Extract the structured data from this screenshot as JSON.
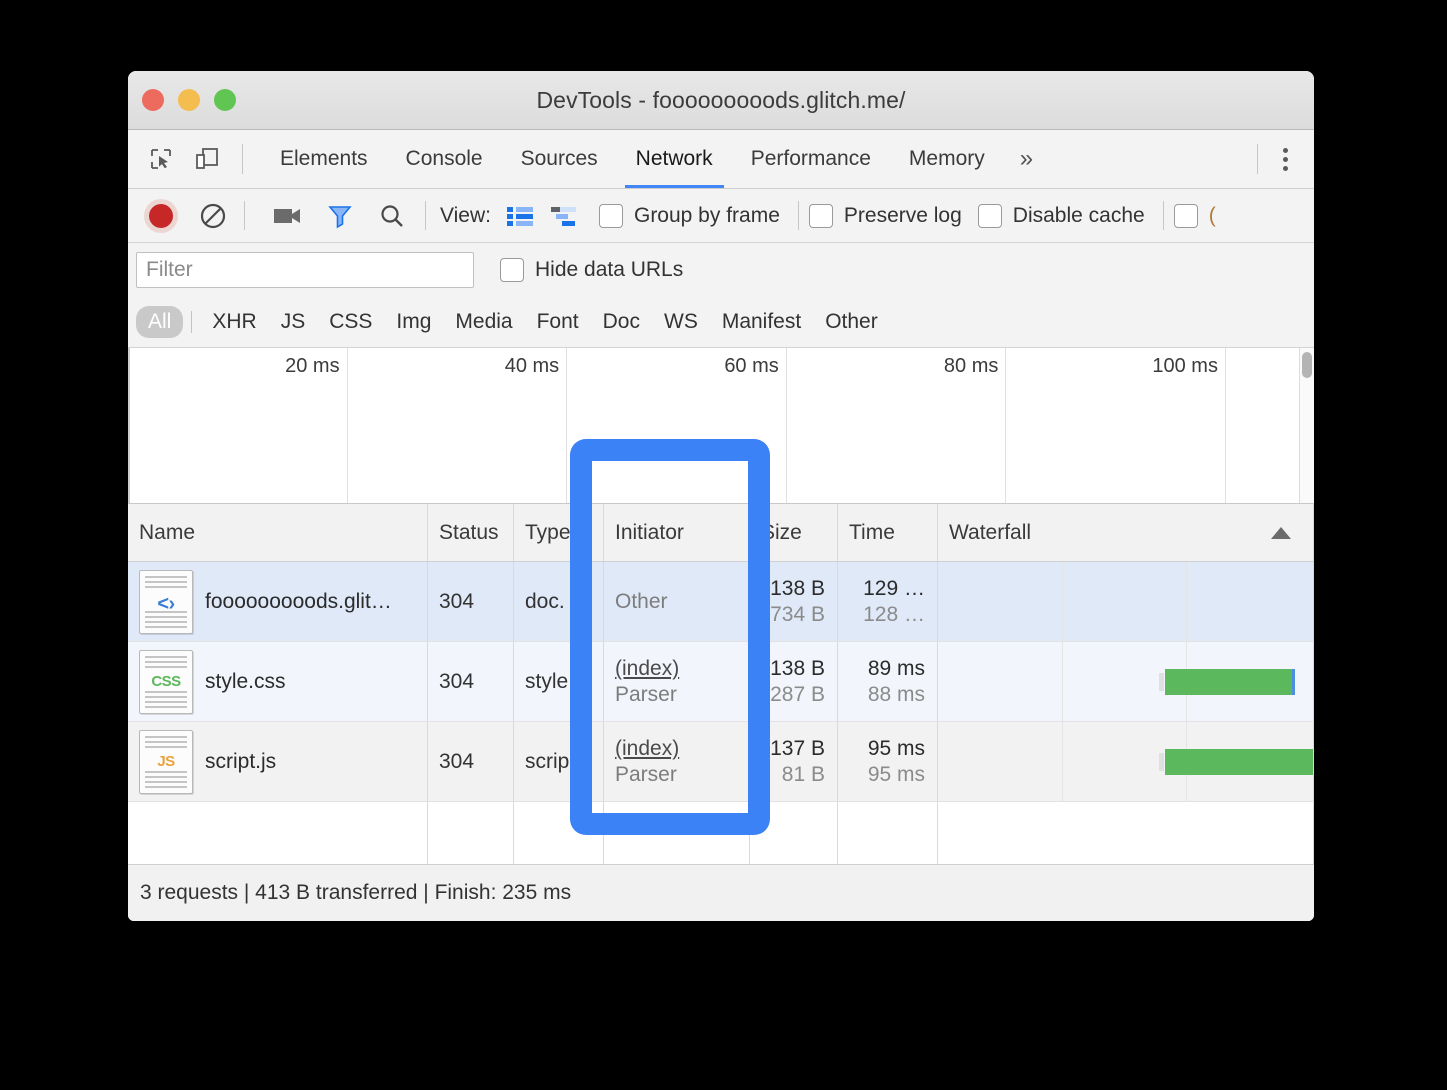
{
  "window": {
    "title": "DevTools - fooooooooods.glitch.me/",
    "traffic_lights": [
      "close",
      "minimize",
      "maximize"
    ]
  },
  "tabbar": {
    "inspect_icon": "inspect-element-icon",
    "device_icon": "device-toolbar-icon",
    "tabs": [
      {
        "label": "Elements",
        "active": false
      },
      {
        "label": "Console",
        "active": false
      },
      {
        "label": "Sources",
        "active": false
      },
      {
        "label": "Network",
        "active": true
      },
      {
        "label": "Performance",
        "active": false
      },
      {
        "label": "Memory",
        "active": false
      }
    ],
    "more_label": "»",
    "menu_icon": "kebab-menu-icon"
  },
  "network_toolbar": {
    "record_icon": "record-icon",
    "clear_icon": "clear-icon",
    "camera_icon": "screenshot-camera-icon",
    "filter_icon": "filter-funnel-icon",
    "search_icon": "search-icon",
    "view_label": "View:",
    "view_list_icon": "list-view-icon",
    "view_waterfall_icon": "waterfall-view-icon",
    "checkboxes": [
      {
        "label": "Group by frame",
        "checked": false
      },
      {
        "label": "Preserve log",
        "checked": false
      },
      {
        "label": "Disable cache",
        "checked": false
      }
    ],
    "cutoff_checkbox": {
      "label": "",
      "checked": false
    }
  },
  "filter_bar": {
    "placeholder": "Filter",
    "value": "",
    "hide_data_urls": {
      "label": "Hide data URLs",
      "checked": false
    }
  },
  "type_filters": {
    "selected": "All",
    "items": [
      "All",
      "XHR",
      "JS",
      "CSS",
      "Img",
      "Media",
      "Font",
      "Doc",
      "WS",
      "Manifest",
      "Other"
    ]
  },
  "overview": {
    "ticks": [
      "20 ms",
      "40 ms",
      "60 ms",
      "80 ms",
      "100 ms"
    ]
  },
  "table": {
    "columns": [
      "Name",
      "Status",
      "Type",
      "Initiator",
      "Size",
      "Time",
      "Waterfall"
    ],
    "sort_column": "Waterfall",
    "sort_direction": "asc",
    "rows": [
      {
        "icon": "html-document-icon",
        "name": "fooooooooods.glit…",
        "status": "304",
        "type": "doc.",
        "initiator_primary": "Other",
        "initiator_secondary": "",
        "initiator_is_link": false,
        "size_primary": "138 B",
        "size_secondary": "734 B",
        "time_primary": "129 …",
        "time_secondary": "128 …",
        "selected": true,
        "bar": null
      },
      {
        "icon": "css-document-icon",
        "name": "style.css",
        "status": "304",
        "type": "style",
        "initiator_primary": "(index)",
        "initiator_secondary": "Parser",
        "initiator_is_link": true,
        "size_primary": "138 B",
        "size_secondary": "287 B",
        "time_primary": "89 ms",
        "time_secondary": "88 ms",
        "selected": false,
        "bar": {
          "left_pct": 60.5,
          "width_pct": 34.0
        }
      },
      {
        "icon": "js-document-icon",
        "name": "script.js",
        "status": "304",
        "type": "scrip",
        "initiator_primary": "(index)",
        "initiator_secondary": "Parser",
        "initiator_is_link": true,
        "size_primary": "137 B",
        "size_secondary": "81 B",
        "time_primary": "95 ms",
        "time_secondary": "95 ms",
        "selected": false,
        "bar": {
          "left_pct": 60.5,
          "width_pct": 40.0
        }
      }
    ]
  },
  "status_bar": {
    "text": "3 requests | 413 B transferred | Finish: 235 ms"
  },
  "annotation": {
    "type": "highlight-rectangle",
    "target": "Initiator column",
    "color": "#3b82f6"
  }
}
